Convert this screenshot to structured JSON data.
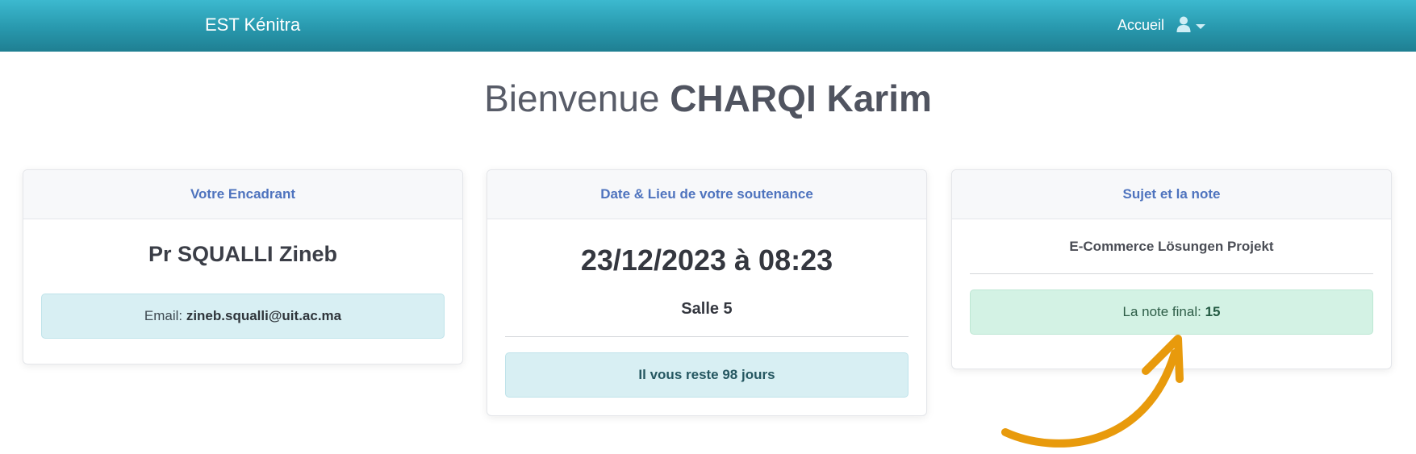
{
  "navbar": {
    "brand": "EST Kénitra",
    "home_label": "Accueil"
  },
  "welcome": {
    "prefix": "Bienvenue",
    "name": "CHARQI Karim"
  },
  "cards": {
    "supervisor": {
      "header": "Votre Encadrant",
      "name": "Pr SQUALLI Zineb",
      "email_label": "Email:",
      "email_value": "zineb.squalli@uit.ac.ma"
    },
    "defense": {
      "header": "Date & Lieu de votre soutenance",
      "datetime": "23/12/2023 à 08:23",
      "room": "Salle 5",
      "remaining": "Il vous reste 98 jours"
    },
    "subject": {
      "header": "Sujet et la note",
      "title": "E-Commerce Lösungen Projekt",
      "grade_label": "La note final:",
      "grade_value": "15"
    }
  },
  "colors": {
    "navbar": "#2898ad",
    "card_header_text": "#4e73be",
    "info_alert": "#d8eff3",
    "success_alert": "#d3f2e4",
    "annotation_arrow": "#e89a0c"
  },
  "icons": {
    "user": "user-icon",
    "caret": "chevron-down-icon",
    "annotation": "arrow-annotation"
  }
}
